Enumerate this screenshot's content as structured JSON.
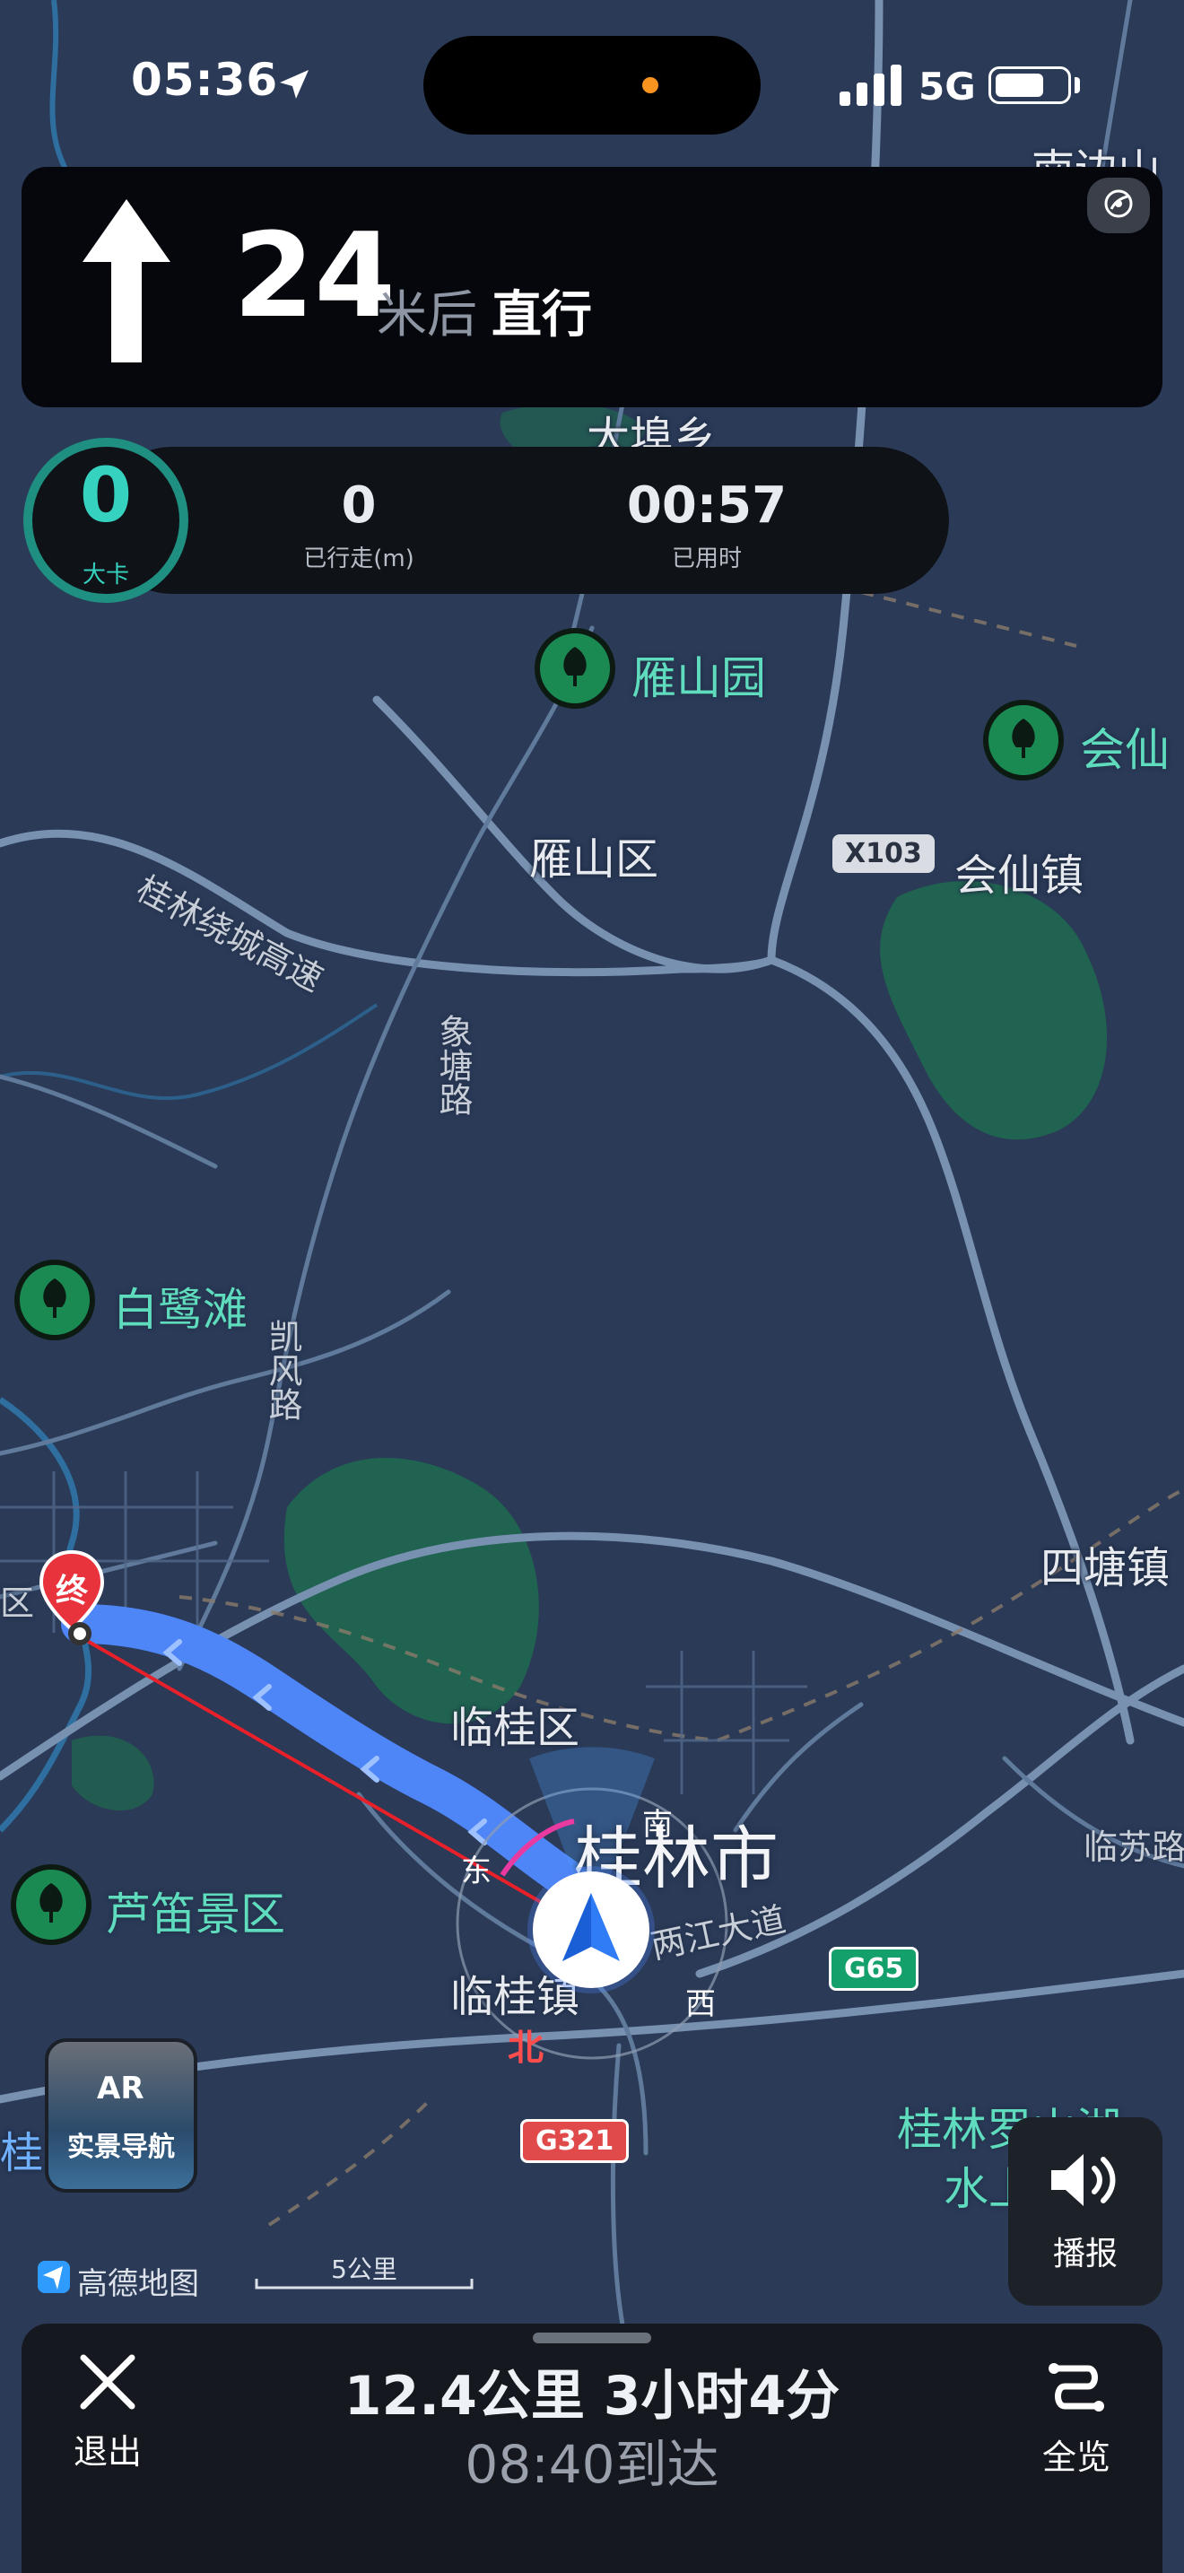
{
  "status": {
    "time": "05:36",
    "network": "5G",
    "battery_level": 0.7
  },
  "guidance": {
    "distance": "24",
    "unit": "米后",
    "action": "直行",
    "arrow_icon": "straight-arrow-icon",
    "extra_icon": "satellite-icon"
  },
  "trip_stats": {
    "speed_value": "0",
    "speed_label": "大卡",
    "distance_value": "0",
    "distance_label": "已行走(m)",
    "time_value": "00:57",
    "time_label": "已用时"
  },
  "map": {
    "labels": {
      "nanbian": "南边山",
      "dabuxiang": "大埠乡",
      "yanshanyuan": "雁山园",
      "huixian_poi": "会仙",
      "yanshanqu": "雁山区",
      "x103": "X103",
      "huixianzhen": "会仙镇",
      "ring_expressway": "桂林绕城高速",
      "xiangtang": "象塘路",
      "bailutan": "白鹭滩",
      "kaifeng": "凯风路",
      "sitangzhen": "四塘镇",
      "qu_edge": "区",
      "lingui": "临桂区",
      "guilin": "桂林市",
      "lingsu": "临苏路",
      "ludi": "芦笛景区",
      "liangjiang": "两江大道",
      "g65": "G65",
      "linguizhen": "临桂镇",
      "g321": "G321",
      "gui_edge": "桂",
      "luoshanhu": "桂林罗山湖",
      "shui": "水上",
      "compass_east": "东",
      "compass_south": "南",
      "compass_west": "西",
      "compass_north": "北",
      "destination_marker": "终"
    },
    "route_color": "#4f86f7",
    "ar_nav_label": "实景导航",
    "ar_icon_text": "AR",
    "broadcast_label": "播报",
    "logo_text": "高德地图",
    "scale_text": "5公里"
  },
  "bottom": {
    "exit_label": "退出",
    "summary": "12.4公里  3小时4分",
    "eta": "08:40到达",
    "overview_label": "全览"
  }
}
